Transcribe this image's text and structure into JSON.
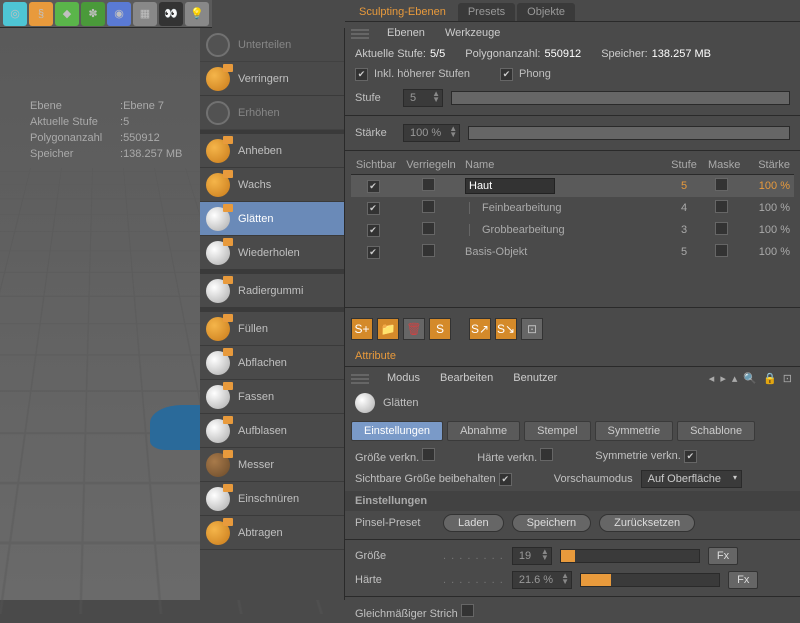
{
  "info": {
    "ebene_label": "Ebene",
    "ebene_val": "Ebene 7",
    "stufe_label": "Aktuelle Stufe",
    "stufe_val": "5",
    "poly_label": "Polygonanzahl",
    "poly_val": "550912",
    "mem_label": "Speicher",
    "mem_val": "138.257 MB"
  },
  "palette": [
    {
      "label": "Unterteilen"
    },
    {
      "label": "Verringern"
    },
    {
      "label": "Erhöhen"
    },
    {
      "label": "Anheben"
    },
    {
      "label": "Wachs"
    },
    {
      "label": "Glätten"
    },
    {
      "label": "Wiederholen"
    },
    {
      "label": "Radiergummi"
    },
    {
      "label": "Füllen"
    },
    {
      "label": "Abflachen"
    },
    {
      "label": "Fassen"
    },
    {
      "label": "Aufblasen"
    },
    {
      "label": "Messer"
    },
    {
      "label": "Einschnüren"
    },
    {
      "label": "Abtragen"
    }
  ],
  "tabs": {
    "sculpt": "Sculpting-Ebenen",
    "presets": "Presets",
    "objects": "Objekte",
    "ebenen": "Ebenen",
    "werkzeuge": "Werkzeuge"
  },
  "status": {
    "stufe_label": "Aktuelle Stufe:",
    "stufe_val": "5/5",
    "poly_label": "Polygonanzahl:",
    "poly_val": "550912",
    "mem_label": "Speicher:",
    "mem_val": "138.257 MB",
    "inkl": "Inkl. höherer Stufen",
    "phong": "Phong",
    "stufe_f": "Stufe",
    "stufe_fv": "5",
    "staerke": "Stärke",
    "staerke_v": "100 %"
  },
  "layer_cols": {
    "vis": "Sichtbar",
    "lock": "Verriegeln",
    "name": "Name",
    "stufe": "Stufe",
    "mask": "Maske",
    "str": "Stärke"
  },
  "layers": [
    {
      "name": "Haut",
      "stufe": "5",
      "str": "100 %",
      "editing": true,
      "indent": false
    },
    {
      "name": "Feinbearbeitung",
      "stufe": "4",
      "str": "100 %",
      "indent": true
    },
    {
      "name": "Grobbearbeitung",
      "stufe": "3",
      "str": "100 %",
      "indent": true
    },
    {
      "name": "Basis-Objekt",
      "stufe": "5",
      "str": "100 %",
      "indent": false
    }
  ],
  "attr": {
    "title": "Attribute",
    "modus": "Modus",
    "bearbeiten": "Bearbeiten",
    "benutzer": "Benutzer",
    "tool": "Glätten",
    "tabs": {
      "einst": "Einstellungen",
      "abnahme": "Abnahme",
      "stempel": "Stempel",
      "sym": "Symmetrie",
      "schab": "Schablone"
    },
    "groesse_v": "Größe verkn.",
    "haerte_v": "Härte verkn.",
    "sym_v": "Symmetrie verkn.",
    "sicht": "Sichtbare Größe beibehalten",
    "vorschau": "Vorschaumodus",
    "vorschau_v": "Auf Oberfläche",
    "section": "Einstellungen",
    "preset": "Pinsel-Preset",
    "laden": "Laden",
    "speichern": "Speichern",
    "reset": "Zurücksetzen",
    "groesse": "Größe",
    "groesse_val": "19",
    "haerte": "Härte",
    "haerte_val": "21.6 %",
    "fx": "Fx",
    "gleich": "Gleichmäßiger Strich"
  }
}
